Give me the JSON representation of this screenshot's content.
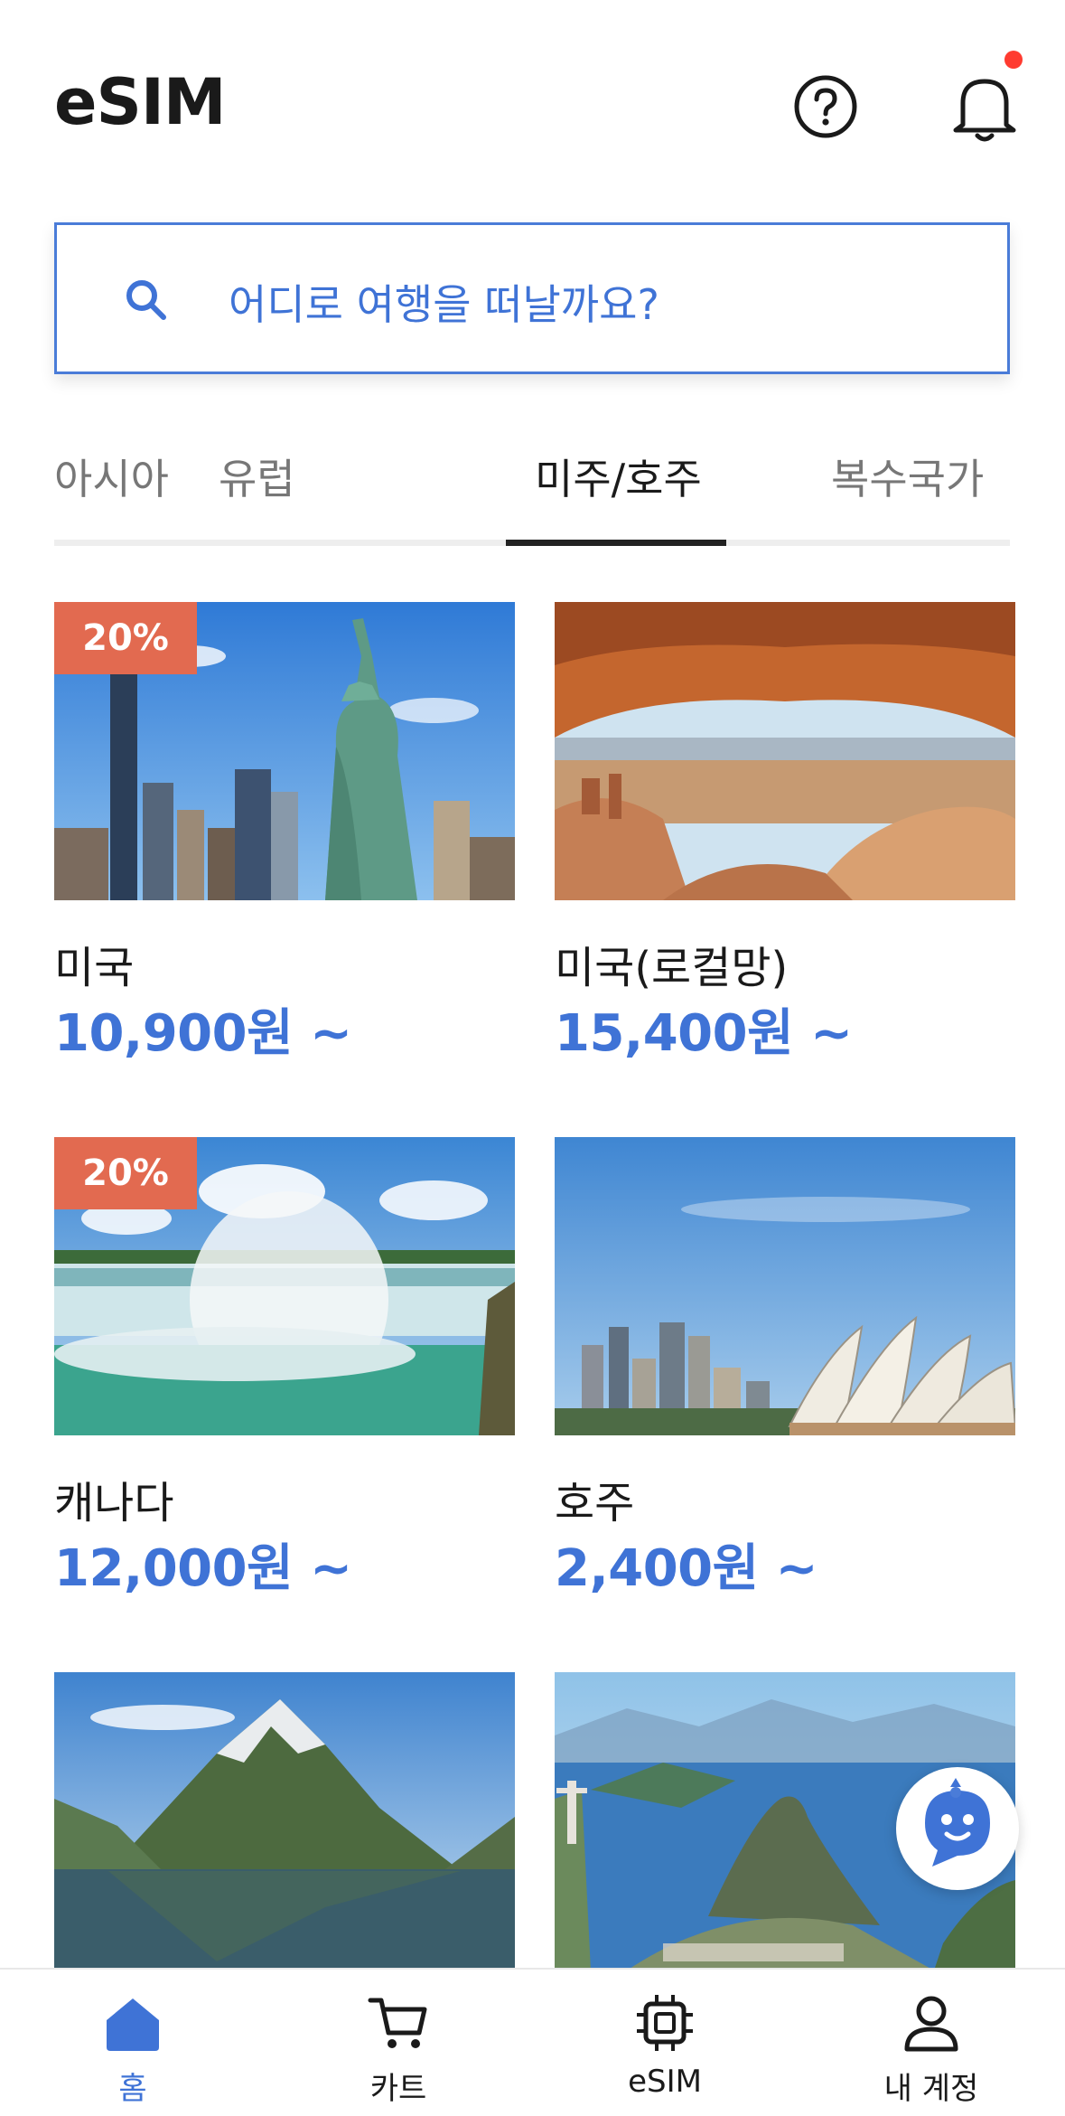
{
  "header": {
    "title": "eSIM",
    "notification_dot_color": "#ff3b30"
  },
  "search": {
    "placeholder": "어디로 여행을 떠날까요?"
  },
  "tabs": [
    {
      "label": "아시아",
      "active": false
    },
    {
      "label": "유럽",
      "active": false
    },
    {
      "label": "미주/호주",
      "active": true
    },
    {
      "label": "복수국가",
      "active": false
    }
  ],
  "products": [
    {
      "name": "미국",
      "price": "10,900원 ~",
      "badge": "20%",
      "image": "new-york-statue-of-liberty"
    },
    {
      "name": "미국(로컬망)",
      "price": "15,400원 ~",
      "badge": null,
      "image": "desert-arch-canyon"
    },
    {
      "name": "캐나다",
      "price": "12,000원 ~",
      "badge": "20%",
      "image": "niagara-falls"
    },
    {
      "name": "호주",
      "price": "2,400원 ~",
      "badge": null,
      "image": "sydney-opera-house"
    },
    {
      "name": null,
      "price": null,
      "badge": null,
      "image": "fjord-mountain"
    },
    {
      "name": null,
      "price": null,
      "badge": null,
      "image": "rio-de-janeiro"
    }
  ],
  "bottom_nav": [
    {
      "label": "홈",
      "icon": "home-icon",
      "active": true
    },
    {
      "label": "카트",
      "icon": "cart-icon",
      "active": false
    },
    {
      "label": "eSIM",
      "icon": "chip-icon",
      "active": false
    },
    {
      "label": "내 계정",
      "icon": "user-icon",
      "active": false
    }
  ],
  "colors": {
    "accent": "#3f73d6",
    "badge": "#e26a50",
    "active_tab_underline": "#222222"
  }
}
